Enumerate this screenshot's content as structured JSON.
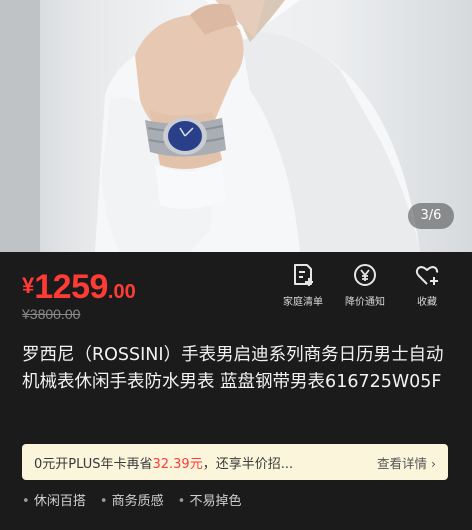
{
  "gallery": {
    "counter": "3/6"
  },
  "price": {
    "currency": "¥",
    "integer": "1259",
    "decimal": ".00",
    "original": "¥3800.00"
  },
  "actions": [
    {
      "label": "家庭清单",
      "icon": "list-add-icon"
    },
    {
      "label": "降价通知",
      "icon": "price-alert-icon"
    },
    {
      "label": "收藏",
      "icon": "heart-plus-icon"
    }
  ],
  "product": {
    "title": "罗西尼（ROSSINI）手表男启迪系列商务日历男士自动机械表休闲手表防水男表 蓝盘钢带男表616725W05F"
  },
  "promo": {
    "prefix": "0元开PLUS年卡再省",
    "amount": "32.39元",
    "suffix": "，还享半价招...",
    "link": "查看详情 ›"
  },
  "tags": [
    "休闲百搭",
    "商务质感",
    "不易掉色"
  ],
  "colors": {
    "price": "#ff3b35",
    "background": "#1b1b1b",
    "promo_bg": "#fbf5dc"
  }
}
